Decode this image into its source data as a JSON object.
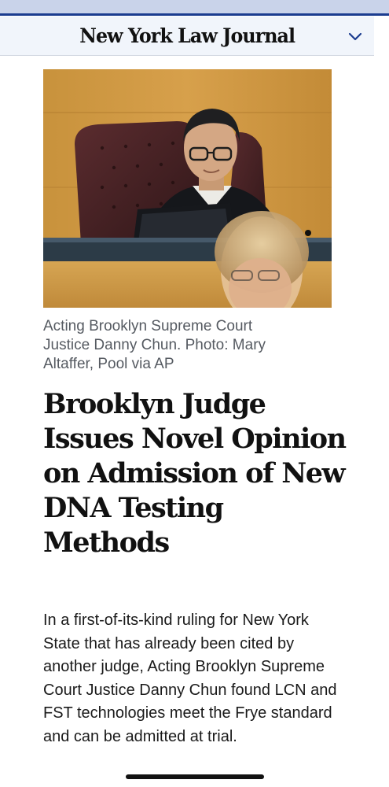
{
  "header": {
    "logo_text": "New York Law Journal",
    "menu_icon": "chevron-down-icon",
    "accent_color": "#1b3c8f"
  },
  "article": {
    "image_alt": "Acting Brooklyn Supreme Court Justice Danny Chun seated at the bench",
    "caption": "Acting Brooklyn Supreme Court Justice Danny Chun. Photo: Mary Altaffer, Pool via AP",
    "headline": "Brooklyn Judge Issues Novel Opinion on Admission of New DNA Testing Methods",
    "summary": "In a first-of-its-kind ruling for New York State that has already been cited by another judge, Acting Brooklyn Supreme Court Justice Danny Chun found LCN and FST technologies meet the Frye standard and can be admitted at trial."
  }
}
